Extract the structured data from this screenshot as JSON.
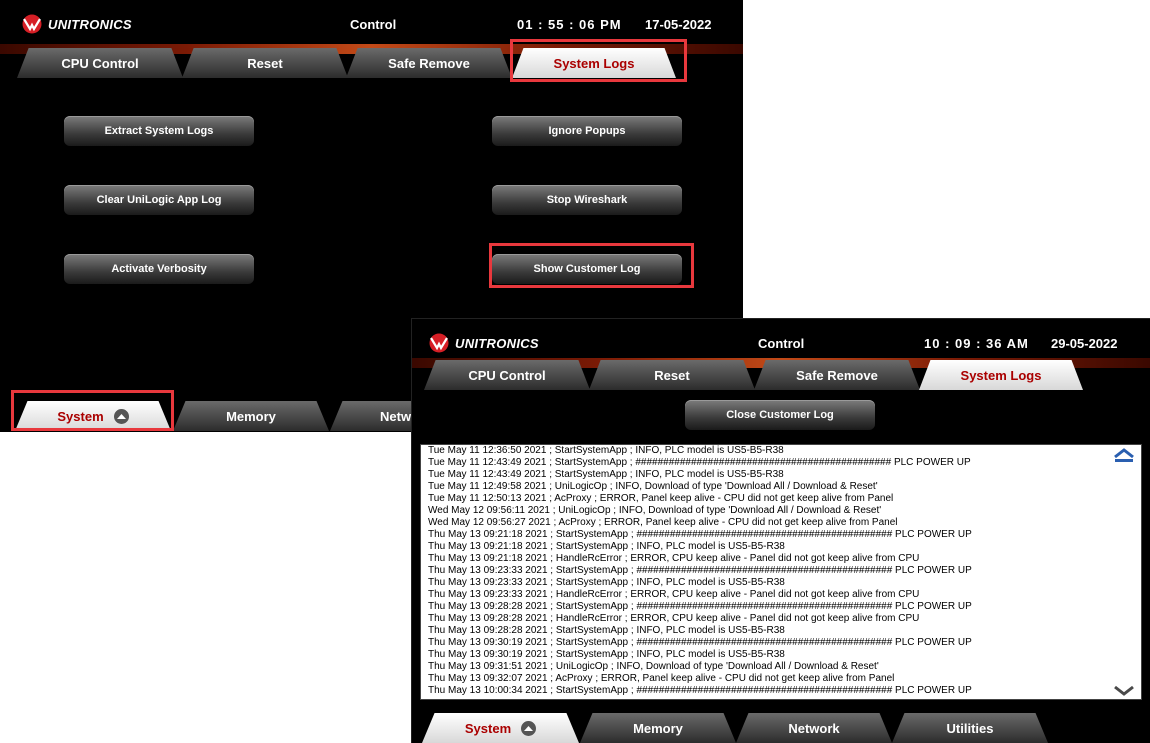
{
  "panel1": {
    "brand": "UNITRONICS",
    "title": "Control",
    "time": "01 : 55 : 06   PM",
    "date": "17-05-2022",
    "tabs": [
      {
        "label": "CPU Control",
        "active": false
      },
      {
        "label": "Reset",
        "active": false
      },
      {
        "label": "Safe Remove",
        "active": false
      },
      {
        "label": "System Logs",
        "active": true
      }
    ],
    "buttons": {
      "extract": "Extract System Logs",
      "ignore": "Ignore Popups",
      "clear": "Clear UniLogic App Log",
      "stop_wireshark": "Stop Wireshark",
      "verbosity": "Activate Verbosity",
      "show_log": "Show Customer Log"
    },
    "bottom_tabs": [
      {
        "label": "System",
        "active": true
      },
      {
        "label": "Memory",
        "active": false
      },
      {
        "label": "Netw",
        "active": false
      }
    ]
  },
  "panel2": {
    "brand": "UNITRONICS",
    "title": "Control",
    "time": "10 : 09 : 36   AM",
    "date": "29-05-2022",
    "tabs": [
      {
        "label": "CPU Control",
        "active": false
      },
      {
        "label": "Reset",
        "active": false
      },
      {
        "label": "Safe Remove",
        "active": false
      },
      {
        "label": "System Logs",
        "active": true
      }
    ],
    "close_button": "Close Customer Log",
    "log_lines": [
      "Tue May 11 12:36:50 2021 ; StartSystemApp ; INFO, PLC model is US5-B5-R38",
      "Tue May 11 12:43:49 2021 ; StartSystemApp ; ############################################## PLC POWER UP",
      "Tue May 11 12:43:49 2021 ; StartSystemApp ; INFO, PLC model is US5-B5-R38",
      "Tue May 11 12:49:58 2021 ; UniLogicOp ; INFO, Download of type 'Download All / Download & Reset'",
      "Tue May 11 12:50:13 2021 ; AcProxy ; ERROR, Panel keep alive - CPU did not get keep alive from Panel",
      "Wed May 12 09:56:11 2021 ; UniLogicOp ; INFO, Download of type 'Download All / Download & Reset'",
      "Wed May 12 09:56:27 2021 ; AcProxy ; ERROR, Panel keep alive - CPU did not get keep alive from Panel",
      "Thu May 13 09:21:18 2021 ; StartSystemApp ; ############################################## PLC POWER UP",
      "Thu May 13 09:21:18 2021 ; StartSystemApp ; INFO, PLC model is US5-B5-R38",
      "Thu May 13 09:21:18 2021 ; HandleRcError ; ERROR, CPU keep alive - Panel did not got keep alive from CPU",
      "Thu May 13 09:23:33 2021 ; StartSystemApp ; ############################################## PLC POWER UP",
      "Thu May 13 09:23:33 2021 ; StartSystemApp ; INFO, PLC model is US5-B5-R38",
      "Thu May 13 09:23:33 2021 ; HandleRcError ; ERROR, CPU keep alive - Panel did not got keep alive from CPU",
      "Thu May 13 09:28:28 2021 ; StartSystemApp ; ############################################## PLC POWER UP",
      "Thu May 13 09:28:28 2021 ; HandleRcError ; ERROR, CPU keep alive - Panel did not got keep alive from CPU",
      "Thu May 13 09:28:28 2021 ; StartSystemApp ; INFO, PLC model is US5-B5-R38",
      "Thu May 13 09:30:19 2021 ; StartSystemApp ; ############################################## PLC POWER UP",
      "Thu May 13 09:30:19 2021 ; StartSystemApp ; INFO, PLC model is US5-B5-R38",
      "Thu May 13 09:31:51 2021 ; UniLogicOp ; INFO, Download of type 'Download All / Download & Reset'",
      "Thu May 13 09:32:07 2021 ; AcProxy ; ERROR, Panel keep alive - CPU did not get keep alive from Panel",
      "Thu May 13 10:00:34 2021 ; StartSystemApp ; ############################################## PLC POWER UP"
    ],
    "bottom_tabs": [
      {
        "label": "System",
        "active": true
      },
      {
        "label": "Memory",
        "active": false
      },
      {
        "label": "Network",
        "active": false
      },
      {
        "label": "Utilities",
        "active": false
      }
    ]
  },
  "colors": {
    "highlight": "#e8383d",
    "active_tab_text": "#aa0000",
    "panel_bg": "#000000"
  }
}
